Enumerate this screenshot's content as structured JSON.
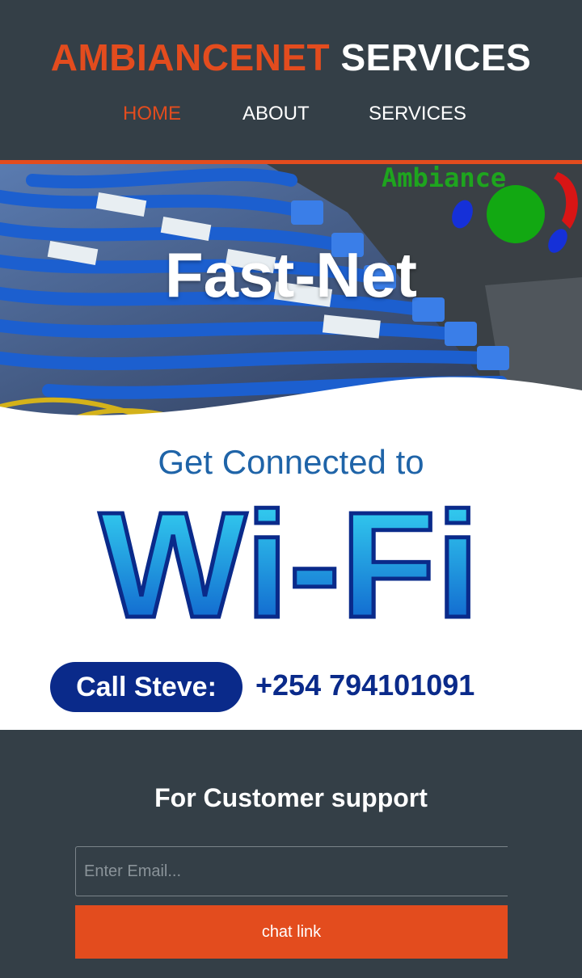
{
  "header": {
    "title_part1": "AMBIANCENET",
    "title_part2": "SERVICES",
    "nav": [
      {
        "label": "HOME",
        "active": true
      },
      {
        "label": "ABOUT",
        "active": false
      },
      {
        "label": "SERVICES",
        "active": false
      }
    ]
  },
  "hero": {
    "headline": "Fast-Net",
    "brand_text": "Ambiance"
  },
  "promo": {
    "line1": "Get Connected to",
    "big_text": "Wi-Fi",
    "call_label": "Call Steve:",
    "phone": "+254 794101091"
  },
  "support": {
    "title": "For Customer support",
    "email_placeholder": "Enter Email...",
    "chat_label": "chat link"
  },
  "colors": {
    "header_bg": "#343f47",
    "accent": "#e34c1e",
    "navy": "#0a2a8a"
  }
}
